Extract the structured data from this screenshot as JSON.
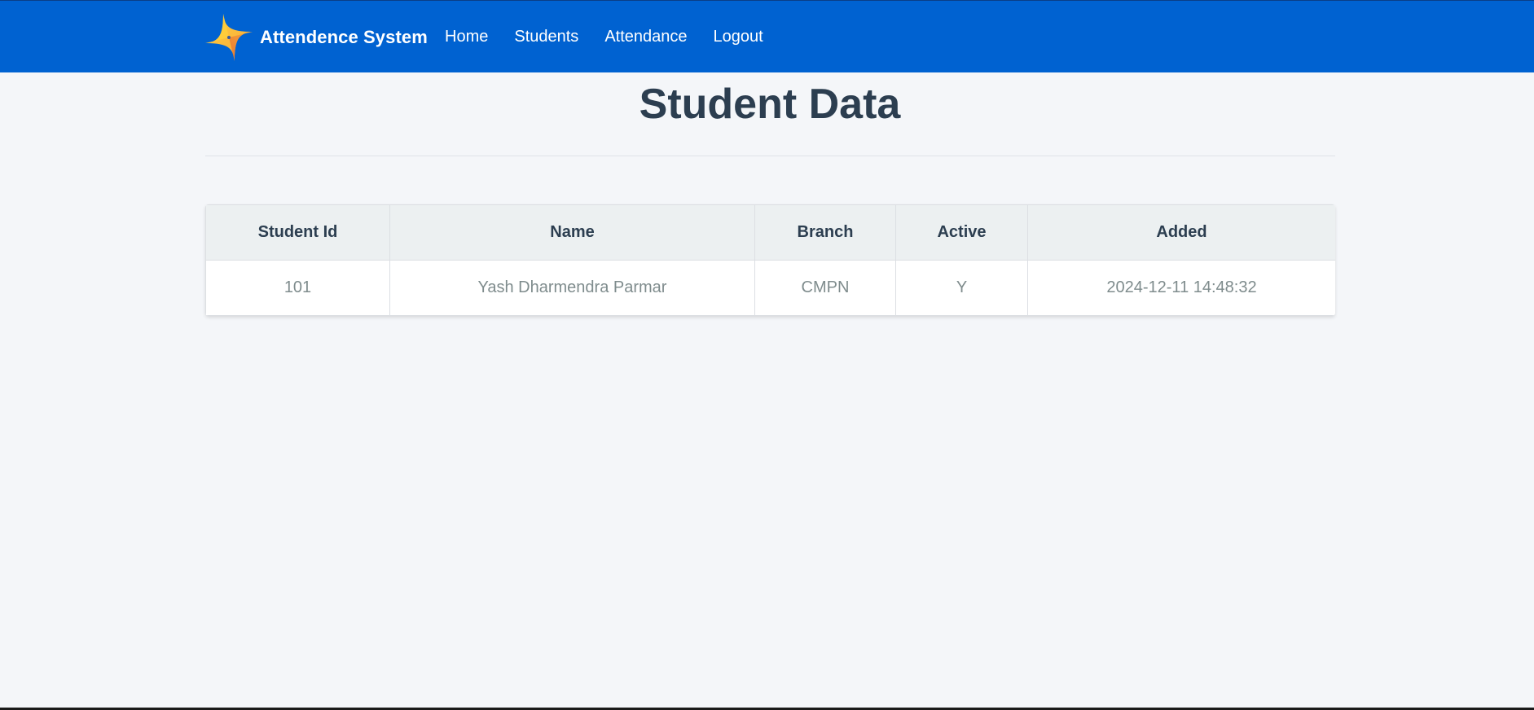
{
  "navbar": {
    "brand": "Attendence System",
    "links": [
      "Home",
      "Students",
      "Attendance",
      "Logout"
    ]
  },
  "page": {
    "title": "Student Data"
  },
  "table": {
    "headers": [
      "Student Id",
      "Name",
      "Branch",
      "Active",
      "Added"
    ],
    "rows": [
      [
        "101",
        "Yash Dharmendra Parmar",
        "CMPN",
        "Y",
        "2024-12-11 14:48:32"
      ]
    ]
  },
  "colors": {
    "navbar": "#0062d1",
    "background": "#f4f6f9",
    "heading": "#2c3e50",
    "cell_text": "#7f8c8d",
    "header_bg": "#ecf0f1"
  },
  "icons": {
    "logo": "sparkle-star-logo-icon"
  }
}
